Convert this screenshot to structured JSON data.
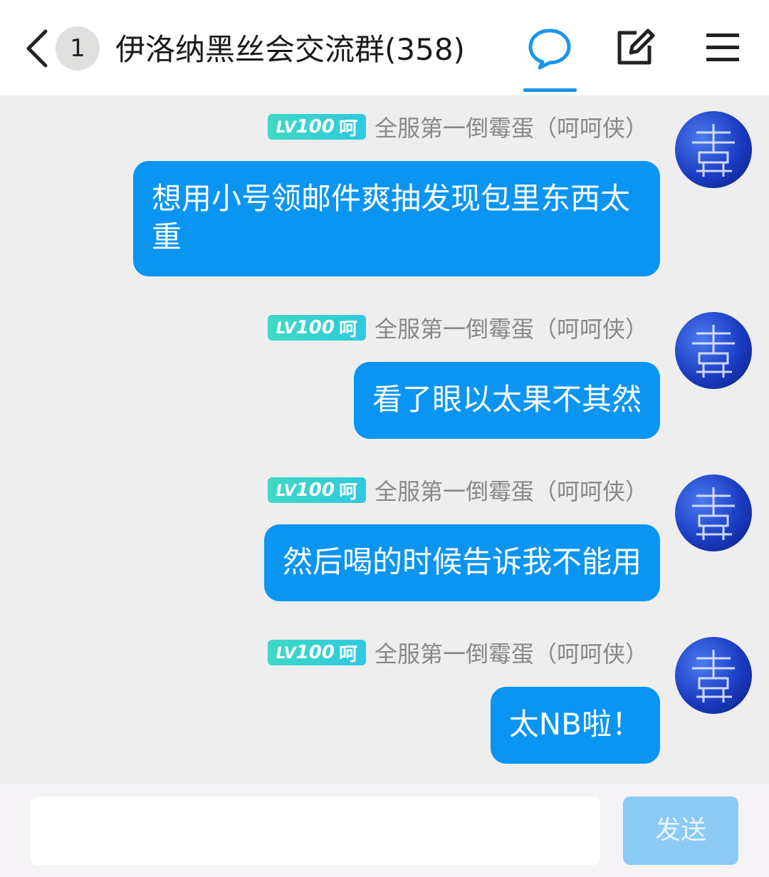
{
  "header": {
    "back_icon": "chevron-left-icon",
    "unread_count": "1",
    "title": "伊洛纳黑丝会交流群(358)",
    "chat_tab_icon": "chat-bubble-icon",
    "edit_icon": "edit-icon",
    "menu_icon": "menu-icon",
    "accent_color": "#1a95e8"
  },
  "messages": [
    {
      "lv_prefix": "LV",
      "lv_number": "100",
      "badge_title": "呵",
      "nickname": "全服第一倒霉蛋（呵呵侠）",
      "text": "想用小号领邮件爽抽发现包里东西太重"
    },
    {
      "lv_prefix": "LV",
      "lv_number": "100",
      "badge_title": "呵",
      "nickname": "全服第一倒霉蛋（呵呵侠）",
      "text": "看了眼以太果不其然"
    },
    {
      "lv_prefix": "LV",
      "lv_number": "100",
      "badge_title": "呵",
      "nickname": "全服第一倒霉蛋（呵呵侠）",
      "text": "然后喝的时候告诉我不能用"
    },
    {
      "lv_prefix": "LV",
      "lv_number": "100",
      "badge_title": "呵",
      "nickname": "全服第一倒霉蛋（呵呵侠）",
      "text": "太NB啦！"
    }
  ],
  "input": {
    "value": "",
    "send_label": "发送"
  },
  "colors": {
    "bubble": "#0a95f2",
    "background": "#eeeeee",
    "badge": "#3ed9c3",
    "send_disabled": "#8ccaf6"
  }
}
